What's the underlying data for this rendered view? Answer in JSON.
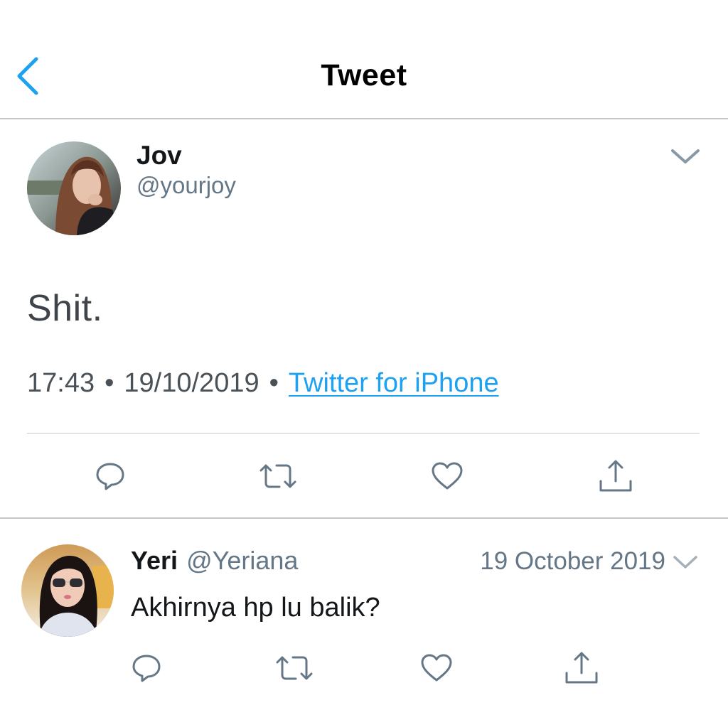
{
  "header": {
    "title": "Tweet",
    "back_icon": "chevron-left-icon"
  },
  "colors": {
    "accent": "#1da1f2",
    "icon_gray": "#657786",
    "divider": "#c3c8cd"
  },
  "tweet": {
    "author_name": "Jov",
    "author_handle": "@yourjoy",
    "text": "Shit.",
    "time": "17:43",
    "date": "19/10/2019",
    "separator": "•",
    "source": "Twitter for iPhone",
    "menu_icon": "chevron-down-icon",
    "actions": [
      "reply-icon",
      "retweet-icon",
      "like-icon",
      "share-icon"
    ]
  },
  "reply": {
    "author_name": "Yeri",
    "author_handle": "@Yeriana",
    "date": "19 October 2019",
    "text": "Akhirnya hp lu balik?",
    "menu_icon": "chevron-down-icon",
    "actions": [
      "reply-icon",
      "retweet-icon",
      "like-icon",
      "share-icon"
    ]
  }
}
